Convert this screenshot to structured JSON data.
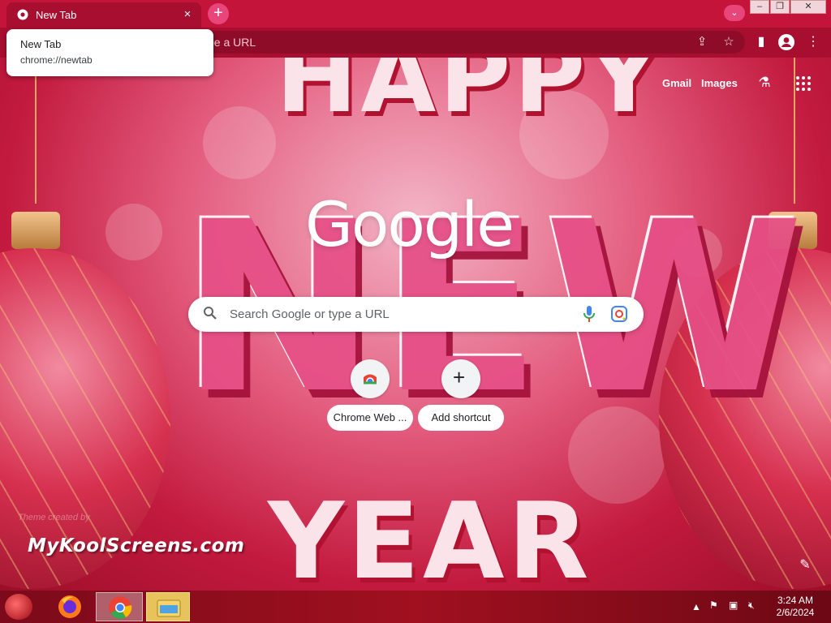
{
  "browser": {
    "tab": {
      "title": "New Tab",
      "close": "×"
    },
    "new_tab_label": "+",
    "omnibox": {
      "placeholder": "Search Google or type a URL",
      "visible_text": "pe a URL"
    },
    "tooltip": {
      "title": "New Tab",
      "url": "chrome://newtab"
    },
    "window_controls": {
      "minimize": "–",
      "maximize": "❐",
      "close": "✕"
    }
  },
  "ntp": {
    "links": {
      "gmail": "Gmail",
      "images": "Images"
    },
    "logo": "Google",
    "search": {
      "placeholder": "Search Google or type a URL"
    },
    "shortcuts": [
      {
        "label": "Chrome Web ..."
      },
      {
        "label": "Add shortcut"
      }
    ],
    "theme_credit": "Theme created by",
    "brand": "MyKoolScreens.com",
    "background_words": {
      "top": "HAPPY",
      "middle": "NEW",
      "bottom": "YEAR"
    }
  },
  "taskbar": {
    "apps": [
      "start-orb",
      "firefox",
      "chrome",
      "file-explorer"
    ],
    "clock": {
      "time": "3:24 AM",
      "date": "2/6/2024"
    }
  },
  "colors": {
    "chrome_accent": "#c4143a",
    "toolbar": "#a80e2f",
    "taskbar": "#a0101f"
  }
}
